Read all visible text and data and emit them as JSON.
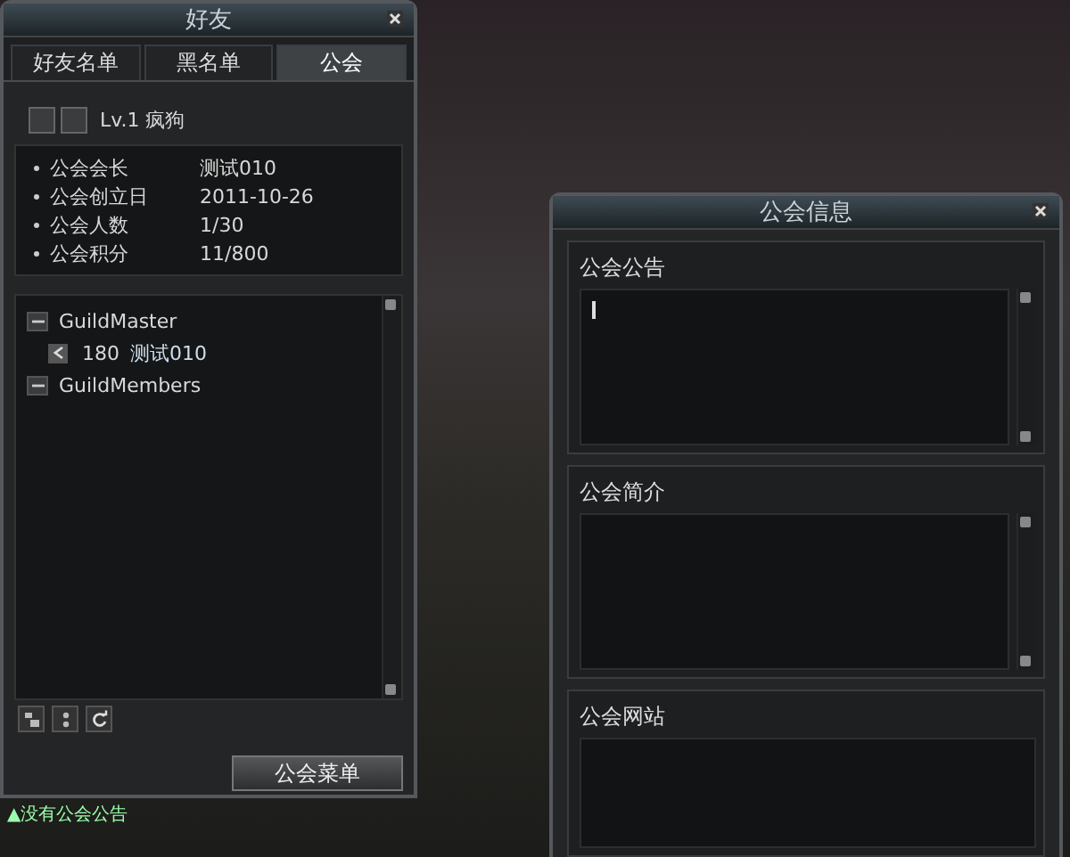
{
  "friends_window": {
    "title": "好友",
    "tabs": [
      {
        "label": "好友名单",
        "selected": false
      },
      {
        "label": "黑名单",
        "selected": false
      },
      {
        "label": "公会",
        "selected": true
      }
    ],
    "guild_header": {
      "level": "Lv.1",
      "name": "疯狗"
    },
    "guild_info": [
      {
        "label": "公会会长",
        "value": "测试010"
      },
      {
        "label": "公会创立日",
        "value": "2011-10-26"
      },
      {
        "label": "公会人数",
        "value": "1/30"
      },
      {
        "label": "公会积分",
        "value": "11/800"
      }
    ],
    "member_tree": [
      {
        "kind": "group",
        "label": "GuildMaster",
        "expanded": true,
        "children": [
          {
            "kind": "member",
            "level": "180",
            "name": "测试010"
          }
        ]
      },
      {
        "kind": "group",
        "label": "GuildMembers",
        "expanded": true
      }
    ],
    "menu_button": "公会菜单"
  },
  "notice_line": "▲没有公会公告",
  "guild_info_window": {
    "title": "公会信息",
    "sections": [
      {
        "kind": "textarea",
        "label": "公会公告",
        "focused": true
      },
      {
        "kind": "textarea",
        "label": "公会简介",
        "focused": false
      },
      {
        "kind": "field",
        "label": "公会网站"
      }
    ]
  }
}
